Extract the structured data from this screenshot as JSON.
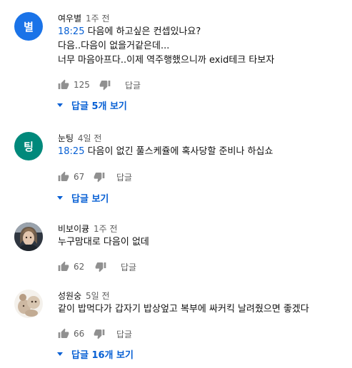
{
  "comments": [
    {
      "avatar_letter": "별",
      "avatar_color": "#1a73e8",
      "author": "여우별",
      "time": "1주 전",
      "timestamp": "18:25",
      "text_first": " 다음에 하고싶은 컨셉있나요?",
      "text_rest": "다음..다음이 없을거같은데...\n너무 마음아프다..이제 역주행했으니까 exid테크 타보자",
      "likes": "125",
      "reply_label": "답글",
      "replies_label": "답글 5개 보기"
    },
    {
      "avatar_letter": "팅",
      "avatar_color": "#00897b",
      "author": "눈팅",
      "time": "4일 전",
      "timestamp": "18:25",
      "text_first": " 다음이 없긴 풀스케쥴에 혹사당할 준비나 하십쇼",
      "text_rest": "",
      "likes": "67",
      "reply_label": "답글",
      "replies_label": "답글 보기"
    },
    {
      "avatar_letter": "",
      "avatar_color": "#3d4550",
      "author": "비보이큥",
      "time": "1주 전",
      "timestamp": "",
      "text_first": "누구맘대로 다음이 없데",
      "text_rest": "",
      "likes": "62",
      "reply_label": "답글",
      "replies_label": ""
    },
    {
      "avatar_letter": "",
      "avatar_color": "#d8c9b8",
      "author": "성원숭",
      "time": "5일 전",
      "timestamp": "",
      "text_first": "같이 밥먹다가 갑자기 밥상엎고 복부에 싸커킥 날려줬으면 좋겠다",
      "text_rest": "",
      "likes": "66",
      "reply_label": "답글",
      "replies_label": "답글 16개 보기"
    }
  ]
}
